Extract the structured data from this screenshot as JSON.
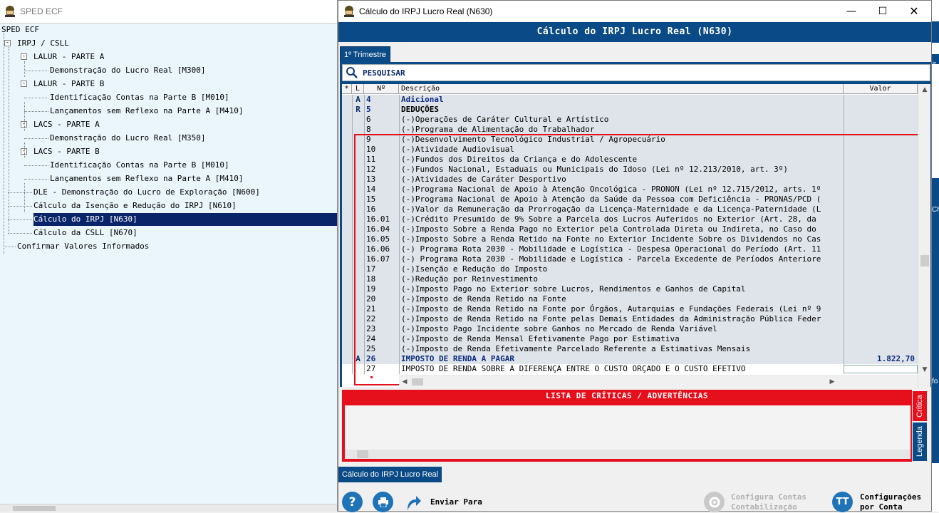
{
  "left_window": {
    "title": "SPED ECF",
    "tree": [
      {
        "label": "SPED ECF",
        "level": 0
      },
      {
        "label": "IRPJ / CSLL",
        "level": 1,
        "expander": "-"
      },
      {
        "label": "LALUR - PARTE A",
        "level": 2,
        "expander": "-"
      },
      {
        "label": "Demonstração do Lucro Real [M300]",
        "level": 3
      },
      {
        "label": "LALUR - PARTE B",
        "level": 2,
        "expander": "-"
      },
      {
        "label": "Identificação Contas na Parte B [M010]",
        "level": 3
      },
      {
        "label": "Lançamentos sem Reflexo na Parte A [M410]",
        "level": 3
      },
      {
        "label": "LACS - PARTE A",
        "level": 2,
        "expander": "-"
      },
      {
        "label": "Demonstração do Lucro Real [M350]",
        "level": 3
      },
      {
        "label": "LACS - PARTE B",
        "level": 2,
        "expander": "-"
      },
      {
        "label": "Identificação Contas na Parte B [M010]",
        "level": 3
      },
      {
        "label": "Lançamentos sem Reflexo na Parte A [M410]",
        "level": 3
      },
      {
        "label": "DLE - Demonstração do Lucro de Exploração [N600]",
        "level": 2
      },
      {
        "label": "Cálculo da Isenção e Redução do IRPJ [N610]",
        "level": 2
      },
      {
        "label": "Cálculo do IRPJ [N630]",
        "level": 2,
        "selected": true
      },
      {
        "label": "Cálculo da CSLL [N670]",
        "level": 2
      },
      {
        "label": "Confirmar Valores Informados",
        "level": 1
      }
    ]
  },
  "dialog": {
    "title": "Cálculo do IRPJ Lucro Real (N630)",
    "header": "Cálculo do IRPJ Lucro Real (N630)",
    "tabs": [
      "1º Trimestre"
    ],
    "search_label": "PESQUISAR",
    "grid": {
      "columns": [
        "*",
        "L",
        "Nº",
        "Descrição",
        "Valor"
      ],
      "rows": [
        {
          "l": "A",
          "n": "4",
          "d": "Adicional",
          "v": "",
          "style": "head-blue"
        },
        {
          "l": "R",
          "n": "5",
          "d": "DEDUÇÕES",
          "v": "",
          "style": "head-black"
        },
        {
          "l": "",
          "n": "6",
          "d": "(-)Operações de Caráter Cultural e Artístico",
          "v": ""
        },
        {
          "l": "",
          "n": "8",
          "d": "(-)Programa de Alimentação do Trabalhador",
          "v": ""
        },
        {
          "l": "",
          "n": "9",
          "d": "(-)Desenvolvimento Tecnológico Industrial / Agropecuário",
          "v": ""
        },
        {
          "l": "",
          "n": "10",
          "d": "(-)Atividade Audiovisual",
          "v": ""
        },
        {
          "l": "",
          "n": "11",
          "d": "(-)Fundos dos Direitos da Criança e do Adolescente",
          "v": ""
        },
        {
          "l": "",
          "n": "12",
          "d": "(-)Fundos Nacional, Estaduais ou Municipais do Idoso (Lei nº 12.213/2010, art. 3º)",
          "v": ""
        },
        {
          "l": "",
          "n": "13",
          "d": "(-)Atividades de Caráter Desportivo",
          "v": ""
        },
        {
          "l": "",
          "n": "14",
          "d": "(-)Programa Nacional de Apoio à Atenção Oncológica - PRONON (Lei nº 12.715/2012, arts. 1º",
          "v": ""
        },
        {
          "l": "",
          "n": "15",
          "d": "(-)Programa Nacional de Apoio à Atenção da Saúde da Pessoa com Deficiência - PRONAS/PCD (",
          "v": ""
        },
        {
          "l": "",
          "n": "16",
          "d": "(-)Valor da Remuneração da Prorrogação da Licença-Maternidade e da Licença-Paternidade (L",
          "v": ""
        },
        {
          "l": "",
          "n": "16.01",
          "d": "(-)Crédito Presumido de 9% Sobre a Parcela dos Lucros Auferidos no Exterior (Art. 28, da",
          "v": ""
        },
        {
          "l": "",
          "n": "16.04",
          "d": "(-)Imposto Sobre a Renda Pago no Exterior pela Controlada Direta ou Indireta, no Caso do",
          "v": ""
        },
        {
          "l": "",
          "n": "16.05",
          "d": "(-)Imposto Sobre a Renda Retido na Fonte no Exterior Incidente Sobre os Dividendos no Cas",
          "v": ""
        },
        {
          "l": "",
          "n": "16.06",
          "d": "(-) Programa Rota 2030 - Mobilidade e Logística - Despesa Operacional do Período (Art. 11",
          "v": ""
        },
        {
          "l": "",
          "n": "16.07",
          "d": "(-) Programa Rota 2030 - Mobilidade e Logística - Parcela Excedente de Períodos Anteriore",
          "v": ""
        },
        {
          "l": "",
          "n": "17",
          "d": "(-)Isenção e Redução do Imposto",
          "v": ""
        },
        {
          "l": "",
          "n": "18",
          "d": "(-)Redução por Reinvestimento",
          "v": ""
        },
        {
          "l": "",
          "n": "19",
          "d": "(-)Imposto Pago no Exterior sobre Lucros, Rendimentos e Ganhos de Capital",
          "v": ""
        },
        {
          "l": "",
          "n": "20",
          "d": "(-)Imposto de Renda Retido na Fonte",
          "v": ""
        },
        {
          "l": "",
          "n": "21",
          "d": "(-)Imposto de Renda Retido na Fonte por Órgãos, Autarquias e Fundações Federais (Lei nº 9",
          "v": ""
        },
        {
          "l": "",
          "n": "22",
          "d": "(-)Imposto de Renda Retido na Fonte pelas Demais Entidades da Administração Pública Feder",
          "v": ""
        },
        {
          "l": "",
          "n": "23",
          "d": "(-)Imposto Pago Incidente sobre Ganhos no Mercado de Renda Variável",
          "v": ""
        },
        {
          "l": "",
          "n": "24",
          "d": "(-)Imposto de Renda Mensal Efetivamente Pago por Estimativa",
          "v": ""
        },
        {
          "l": "",
          "n": "25",
          "d": "(-)Imposto de Renda Efetivamente Parcelado Referente a Estimativas Mensais",
          "v": ""
        },
        {
          "l": "A",
          "n": "26",
          "d": "IMPOSTO DE RENDA A PAGAR",
          "v": "1.822,70",
          "style": "head-blue"
        },
        {
          "l": "",
          "n": "27",
          "d": "IMPOSTO DE RENDA SOBRE A DIFERENÇA ENTRE O CUSTO ORÇADO E O CUSTO EFETIVO",
          "v": "",
          "style": "white"
        }
      ]
    },
    "criticas_header": "LISTA DE CRÍTICAS / ADVERTÊNCIAS",
    "side_tabs": [
      "Crítica",
      "Legenda"
    ],
    "bottom_tab": "Cálculo do IRPJ Lucro Real",
    "buttons": {
      "send": "Enviar Para",
      "config_contas_1": "Configura Contas",
      "config_contas_2": "Contabilização",
      "config_conta_1": "Configurações",
      "config_conta_2": "por Conta"
    }
  },
  "right_strip": {
    "fragments": [
      "ir",
      "Ch",
      "fo"
    ]
  },
  "colors": {
    "header_blue": "#0a4a86",
    "highlight_red": "#e4101a",
    "selection": "#0a246a"
  }
}
